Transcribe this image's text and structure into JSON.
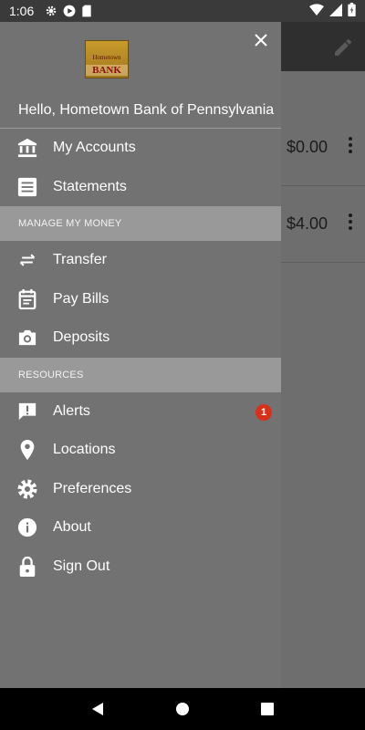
{
  "status_bar": {
    "time": "1:06",
    "icons": [
      "gear-icon",
      "play-icon",
      "sd-card-icon",
      "wifi-icon",
      "signal-icon",
      "battery-icon"
    ]
  },
  "background": {
    "rows": [
      {
        "amount": "$0.00"
      },
      {
        "amount": "$4.00"
      }
    ]
  },
  "drawer": {
    "logo": {
      "top_text": "Hometown",
      "bottom_text": "BANK"
    },
    "greeting": "Hello,  Hometown Bank of Pennsylvania",
    "items_main": [
      {
        "label": "My Accounts",
        "icon": "bank-icon"
      },
      {
        "label": "Statements",
        "icon": "statements-icon"
      }
    ],
    "section_money": "MANAGE MY MONEY",
    "items_money": [
      {
        "label": "Transfer",
        "icon": "transfer-icon"
      },
      {
        "label": "Pay Bills",
        "icon": "pay-bills-icon"
      },
      {
        "label": "Deposits",
        "icon": "camera-icon"
      }
    ],
    "section_resources": "RESOURCES",
    "items_resources": [
      {
        "label": "Alerts",
        "icon": "alert-icon",
        "badge": "1"
      },
      {
        "label": "Locations",
        "icon": "location-icon"
      },
      {
        "label": "Preferences",
        "icon": "gear-icon"
      },
      {
        "label": "About",
        "icon": "info-icon"
      },
      {
        "label": "Sign Out",
        "icon": "lock-icon"
      }
    ]
  },
  "colors": {
    "drawer_bg": "#727272",
    "section_bg": "#999999",
    "badge": "#d9301c"
  }
}
